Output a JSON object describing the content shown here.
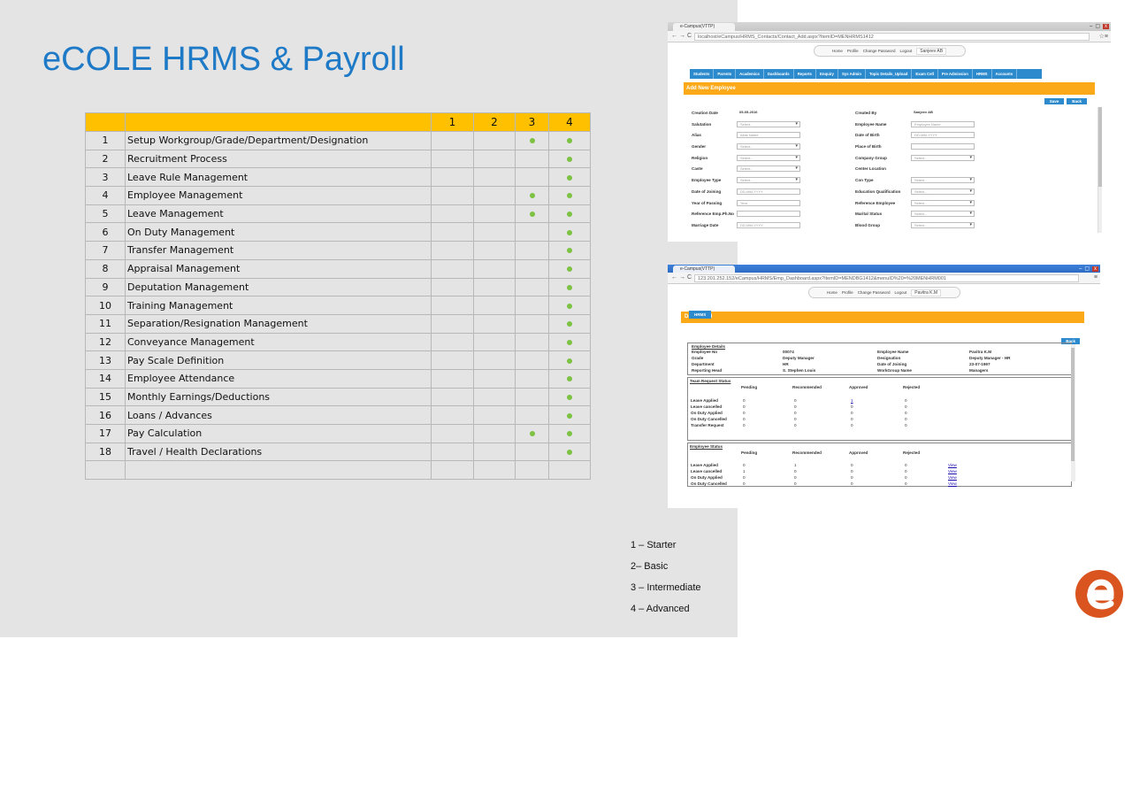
{
  "slide": {
    "title": "eCOLE HRMS & Payroll",
    "accent_color": "#1e7ac6",
    "header_color": "#ffc000",
    "dot_color": "#7dc242"
  },
  "table": {
    "headers": [
      "",
      "",
      "1",
      "2",
      "3",
      "4"
    ],
    "rows": [
      {
        "num": "1",
        "name": "Setup Workgroup/Grade/Department/Designation",
        "levels": [
          false,
          false,
          true,
          true
        ]
      },
      {
        "num": "2",
        "name": "Recruitment Process",
        "levels": [
          false,
          false,
          false,
          true
        ]
      },
      {
        "num": "3",
        "name": "Leave Rule Management",
        "levels": [
          false,
          false,
          false,
          true
        ]
      },
      {
        "num": "4",
        "name": "Employee Management",
        "levels": [
          false,
          false,
          true,
          true
        ]
      },
      {
        "num": "5",
        "name": "Leave Management",
        "levels": [
          false,
          false,
          true,
          true
        ]
      },
      {
        "num": "6",
        "name": "On Duty Management",
        "levels": [
          false,
          false,
          false,
          true
        ]
      },
      {
        "num": "7",
        "name": "Transfer Management",
        "levels": [
          false,
          false,
          false,
          true
        ]
      },
      {
        "num": "8",
        "name": "Appraisal Management",
        "levels": [
          false,
          false,
          false,
          true
        ]
      },
      {
        "num": "9",
        "name": "Deputation Management",
        "levels": [
          false,
          false,
          false,
          true
        ]
      },
      {
        "num": "10",
        "name": "Training Management",
        "levels": [
          false,
          false,
          false,
          true
        ]
      },
      {
        "num": "11",
        "name": "Separation/Resignation Management",
        "levels": [
          false,
          false,
          false,
          true
        ]
      },
      {
        "num": "12",
        "name": "Conveyance Management",
        "levels": [
          false,
          false,
          false,
          true
        ]
      },
      {
        "num": "13",
        "name": "Pay Scale Definition",
        "levels": [
          false,
          false,
          false,
          true
        ]
      },
      {
        "num": "14",
        "name": "Employee Attendance",
        "levels": [
          false,
          false,
          false,
          true
        ]
      },
      {
        "num": "15",
        "name": "Monthly Earnings/Deductions",
        "levels": [
          false,
          false,
          false,
          true
        ]
      },
      {
        "num": "16",
        "name": "Loans / Advances",
        "levels": [
          false,
          false,
          false,
          true
        ]
      },
      {
        "num": "17",
        "name": "Pay Calculation",
        "levels": [
          false,
          false,
          true,
          true
        ]
      },
      {
        "num": "18",
        "name": "Travel / Health Declarations",
        "levels": [
          false,
          false,
          false,
          true
        ]
      },
      {
        "num": "",
        "name": "",
        "levels": [
          false,
          false,
          false,
          false
        ]
      }
    ]
  },
  "legend": [
    "1 – Starter",
    "2– Basic",
    "3 – Intermediate",
    "4 – Advanced"
  ],
  "screenshot1": {
    "tab": "e-Campus(VTTP)",
    "url": "localhost/eCampus/HRMS_Contacts/Contact_Add.aspx?ItemID=MENHRMS1412",
    "top_links": [
      "Home",
      "Profile",
      "Change Password",
      "Logout"
    ],
    "user": "Sanjeev AB",
    "nav": [
      "Students",
      "Parents",
      "Academics",
      "Dashboards",
      "Reports",
      "Enquiry",
      "Sys Admin",
      "Topic Details_Upload",
      "Exam Cell",
      "Pre Admission",
      "HRMS",
      "Accounts"
    ],
    "section": "Add New Employee",
    "buttons": [
      "Save",
      "Back"
    ],
    "form_left": [
      {
        "label": "Creation Date",
        "value": "05-05-2016",
        "kind": "plain"
      },
      {
        "label": "Salutation",
        "value": "Select...",
        "kind": "sel"
      },
      {
        "label": "Alias",
        "value": "Alias Name",
        "kind": "input"
      },
      {
        "label": "Gender",
        "value": "Select...",
        "kind": "sel"
      },
      {
        "label": "Religion",
        "value": "Select...",
        "kind": "sel"
      },
      {
        "label": "Caste",
        "value": "Select...",
        "kind": "sel"
      },
      {
        "label": "Employee Type",
        "value": "Select...",
        "kind": "sel"
      },
      {
        "label": "Date of Joining",
        "value": "DD-MM-YYYY",
        "kind": "input"
      },
      {
        "label": "Year of Passing",
        "value": "Year",
        "kind": "input"
      },
      {
        "label": "Reference Emp.Ph.No",
        "value": "",
        "kind": "input"
      },
      {
        "label": "Marriage Date",
        "value": "DD-MM-YYYY",
        "kind": "input"
      }
    ],
    "form_right": [
      {
        "label": "Created By",
        "value": "Sanjeev AB",
        "kind": "plain"
      },
      {
        "label": "Employee Name",
        "value": "Employee Name",
        "kind": "input"
      },
      {
        "label": "Date of Birth",
        "value": "DD-MM-YYYY",
        "kind": "input"
      },
      {
        "label": "Place of Birth",
        "value": "",
        "kind": "input"
      },
      {
        "label": "Company Group",
        "value": "Select...",
        "kind": "sel"
      },
      {
        "label": "Center Location",
        "value": "",
        "kind": "none"
      },
      {
        "label": "Con Type",
        "value": "Select...",
        "kind": "sel"
      },
      {
        "label": "Education Qualification",
        "value": "Select...",
        "kind": "sel"
      },
      {
        "label": "Reference Employee",
        "value": "Select...",
        "kind": "sel"
      },
      {
        "label": "Marital Status",
        "value": "Select...",
        "kind": "sel"
      },
      {
        "label": "Blood Group",
        "value": "Select...",
        "kind": "sel"
      }
    ]
  },
  "screenshot2": {
    "tab": "e-Campus(VTTP)",
    "url": "123.201.252.152/eCampus/HRMS/Emp_Dashboard.aspx?ItemID=MENDBG1412&menuID%20=%20MENHRM001",
    "top_links": [
      "Home",
      "Profile",
      "Change Password",
      "Logout"
    ],
    "user": "Pavitra K.M",
    "hrms_tab": "HRMS",
    "section": "Dashboard",
    "back": "Back",
    "employee_details": {
      "heading": "Employee Details",
      "left": [
        [
          "Employee No",
          "00074"
        ],
        [
          "Grade",
          "Deputy Manager"
        ],
        [
          "Department",
          "HR"
        ],
        [
          "Reporting Head",
          "S. Stephen Louis"
        ]
      ],
      "right": [
        [
          "Employee Name",
          "Pavitra K.M"
        ],
        [
          "Designation",
          "Deputy Manager - HR"
        ],
        [
          "Date of Joining",
          "23-07-1997"
        ],
        [
          "WorkGroup Name",
          "Managers"
        ]
      ]
    },
    "team_request": {
      "heading": "Team Request Status",
      "columns": [
        "Pending",
        "Recommended",
        "Approved",
        "Rejected"
      ],
      "rows": [
        [
          "Leave Applied",
          "0",
          "0",
          "1",
          "0"
        ],
        [
          "Leave cancelled",
          "0",
          "0",
          "0",
          "0"
        ],
        [
          "On Duty Applied",
          "0",
          "0",
          "0",
          "0"
        ],
        [
          "On Duty Cancelled",
          "0",
          "0",
          "0",
          "0"
        ],
        [
          "Transfer Request",
          "0",
          "0",
          "0",
          "0"
        ]
      ]
    },
    "employee_status": {
      "heading": "Employee Status",
      "columns": [
        "Pending",
        "Recommended",
        "Approved",
        "Rejected"
      ],
      "link": "View",
      "rows": [
        [
          "Leave Applied",
          "0",
          "1",
          "0",
          "0"
        ],
        [
          "Leave cancelled",
          "1",
          "0",
          "0",
          "0"
        ],
        [
          "On Duty Applied",
          "0",
          "0",
          "0",
          "0"
        ],
        [
          "On Duty Cancelled",
          "0",
          "0",
          "0",
          "0"
        ]
      ]
    }
  },
  "logo": {
    "letter": "e",
    "color": "#d9541e"
  }
}
